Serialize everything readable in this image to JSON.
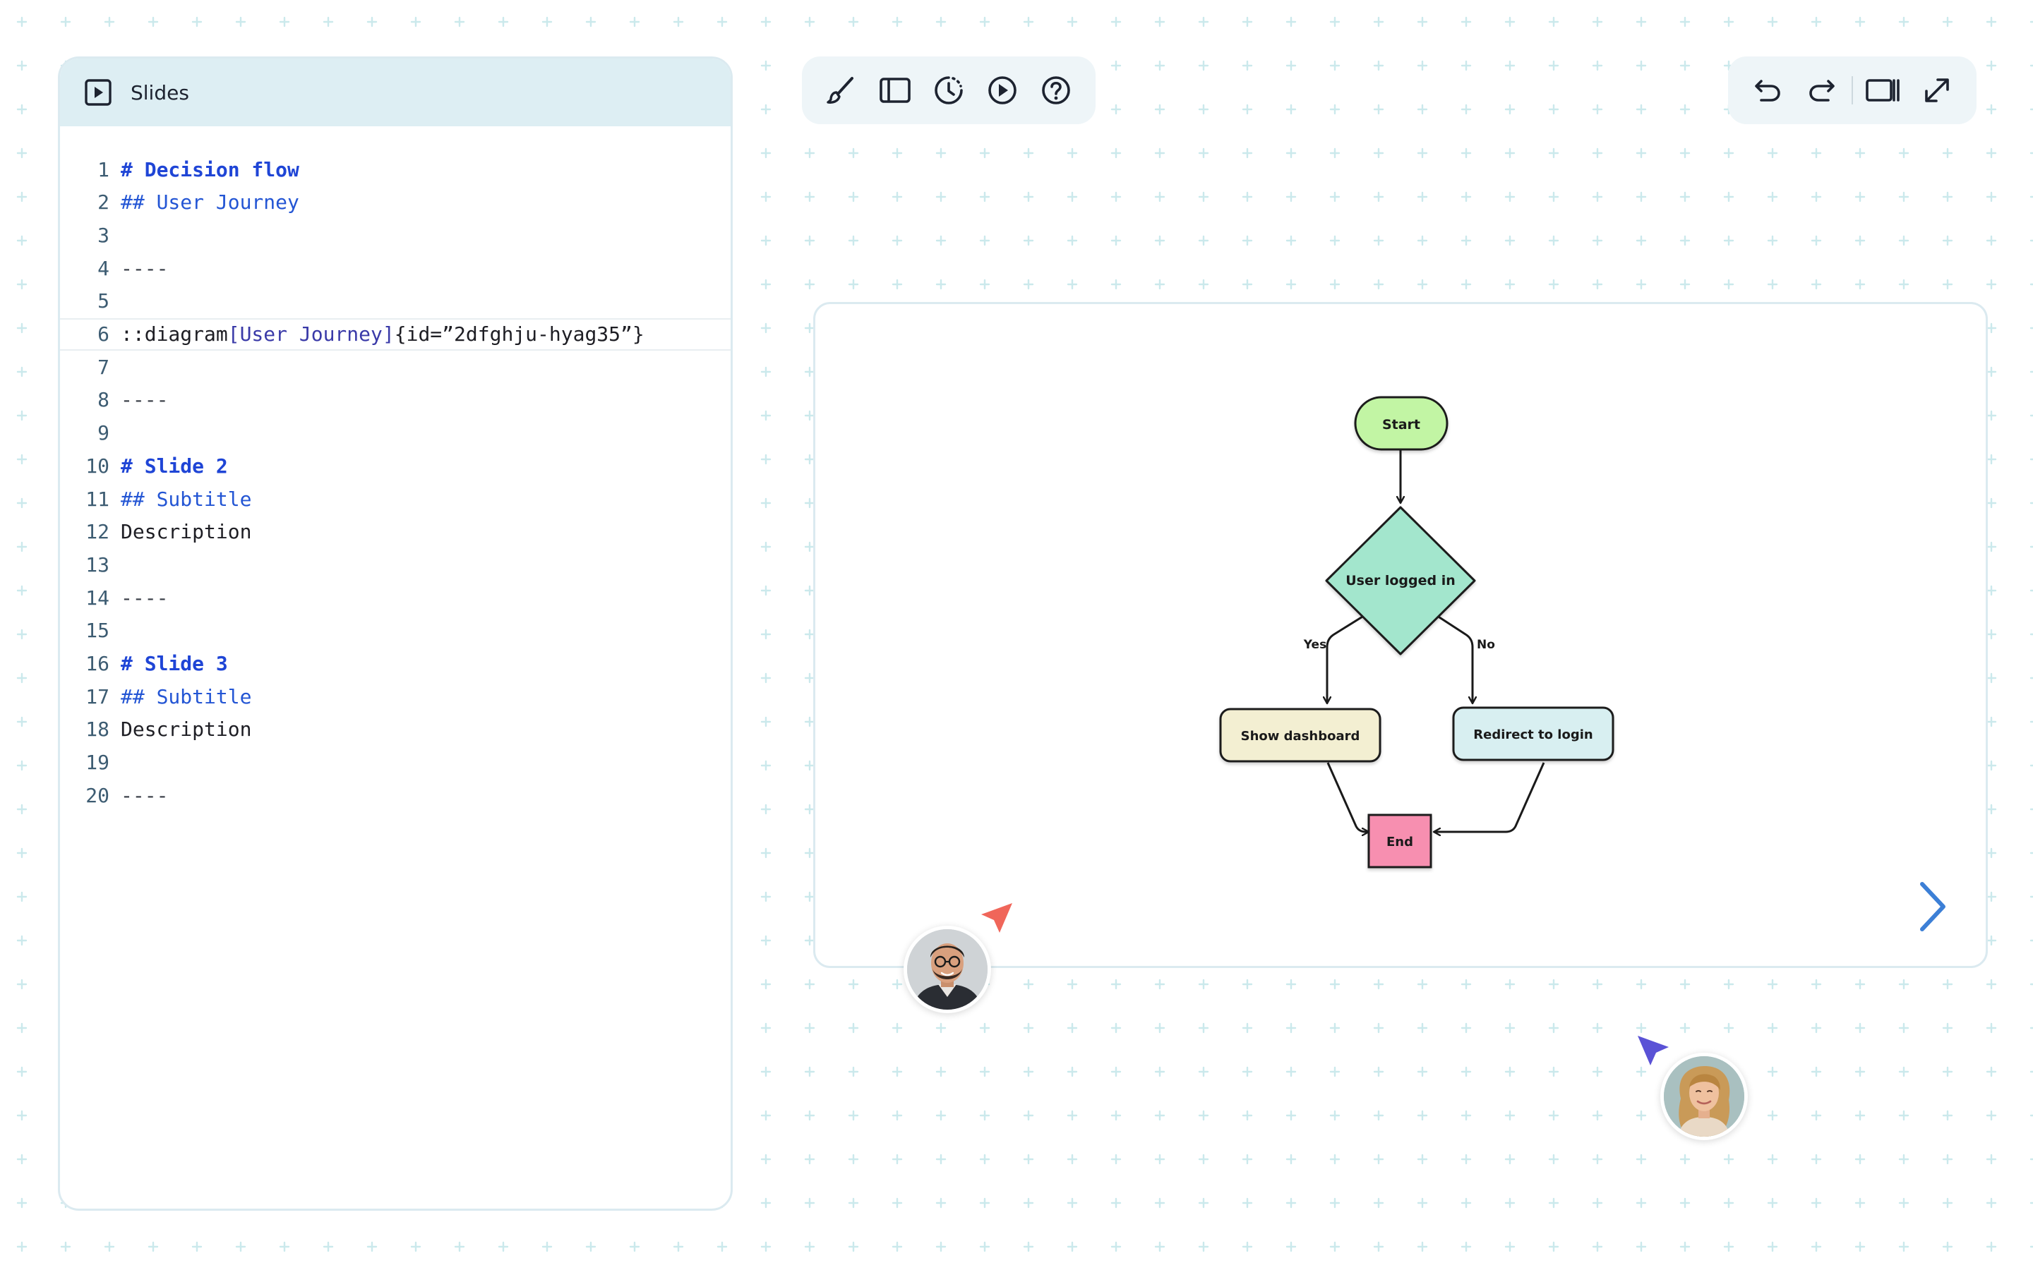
{
  "panel": {
    "title": "Slides"
  },
  "editor": {
    "lines": [
      {
        "num": "1",
        "tokens": [
          {
            "t": "# Decision flow",
            "k": "h1"
          }
        ]
      },
      {
        "num": "2",
        "tokens": [
          {
            "t": "## User Journey",
            "k": "h2"
          }
        ]
      },
      {
        "num": "3",
        "tokens": []
      },
      {
        "num": "4",
        "tokens": [
          {
            "t": "----",
            "k": "sep"
          }
        ]
      },
      {
        "num": "5",
        "tokens": []
      },
      {
        "num": "6",
        "active": true,
        "tokens": [
          {
            "t": "::diagram",
            "k": "plain"
          },
          {
            "t": "[User Journey]",
            "k": "arg"
          },
          {
            "t": "{id=”2dfghju-hyag35”}",
            "k": "plain"
          }
        ]
      },
      {
        "num": "7",
        "tokens": []
      },
      {
        "num": "8",
        "tokens": [
          {
            "t": "----",
            "k": "sep"
          }
        ]
      },
      {
        "num": "9",
        "tokens": []
      },
      {
        "num": "10",
        "tokens": [
          {
            "t": "# Slide 2",
            "k": "h1"
          }
        ]
      },
      {
        "num": "11",
        "tokens": [
          {
            "t": "## Subtitle",
            "k": "h2"
          }
        ]
      },
      {
        "num": "12",
        "tokens": [
          {
            "t": "Description",
            "k": "plain"
          }
        ]
      },
      {
        "num": "13",
        "tokens": []
      },
      {
        "num": "14",
        "tokens": [
          {
            "t": "----",
            "k": "sep"
          }
        ]
      },
      {
        "num": "15",
        "tokens": []
      },
      {
        "num": "16",
        "tokens": [
          {
            "t": "# Slide 3",
            "k": "h1"
          }
        ]
      },
      {
        "num": "17",
        "tokens": [
          {
            "t": "## Subtitle",
            "k": "h2"
          }
        ]
      },
      {
        "num": "18",
        "tokens": [
          {
            "t": "Description",
            "k": "plain"
          }
        ]
      },
      {
        "num": "19",
        "tokens": []
      },
      {
        "num": "20",
        "tokens": [
          {
            "t": "----",
            "k": "sep"
          }
        ]
      }
    ]
  },
  "toolbar_left": {
    "icons": [
      "brush-icon",
      "sidebar-layout-icon",
      "timer-icon",
      "play-icon",
      "help-icon"
    ]
  },
  "toolbar_right": {
    "icons": [
      "undo-icon",
      "redo-icon",
      "split-view-icon",
      "expand-icon"
    ]
  },
  "diagram": {
    "nodes": {
      "start": "Start",
      "decision": "User logged in",
      "yes_branch": "Show dashboard",
      "no_branch": "Redirect to login",
      "end": "End"
    },
    "edges": {
      "yes": "Yes",
      "no": "No"
    },
    "colors": {
      "start": "#c2f5a4",
      "decision": "#a3e6cd",
      "yes_branch": "#f3efd2",
      "no_branch": "#d8eff1",
      "end": "#f78fb0"
    }
  },
  "colors": {
    "accent": "#3c7fd6",
    "cursor_1": "#f0665a",
    "cursor_2": "#5a52d6",
    "grid": "#c9e7ea"
  }
}
